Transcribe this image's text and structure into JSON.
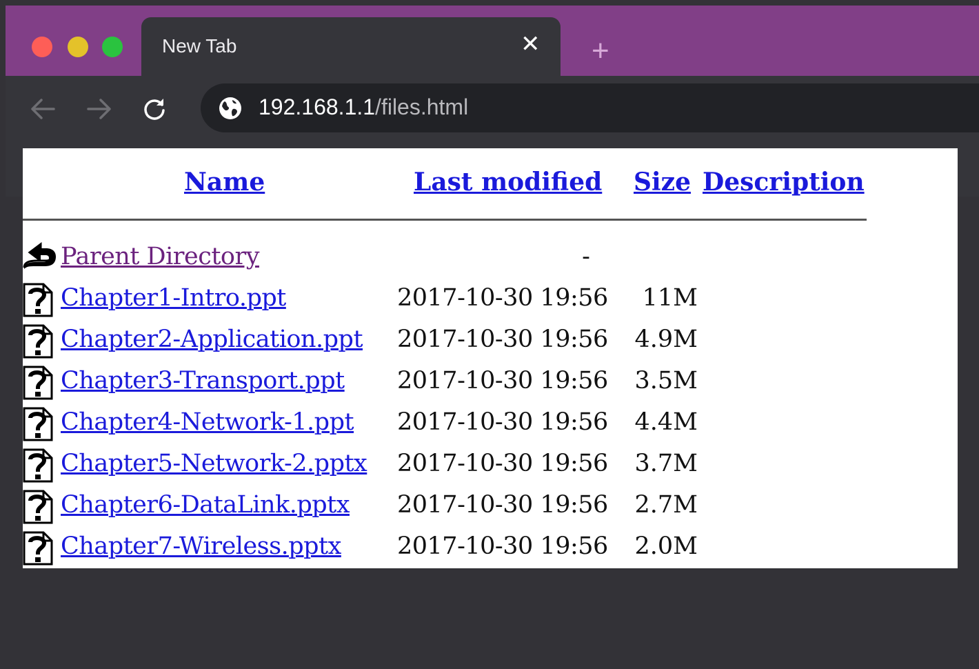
{
  "browser": {
    "tab_title": "New Tab",
    "tab_close": "✕",
    "new_tab": "+",
    "url_host": "192.168.1.1",
    "url_path": "/files.html",
    "accent": "#813f87"
  },
  "listing": {
    "headers": {
      "name": "Name",
      "last_modified": "Last modified",
      "size": "Size",
      "description": "Description"
    },
    "parent": {
      "label": "Parent Directory",
      "size": "-",
      "icon": "back-arrow-icon"
    },
    "files": [
      {
        "name": "Chapter1-Intro.ppt",
        "date": "2017-10-30 19:56",
        "size": "11M",
        "icon": "unknown-file-icon"
      },
      {
        "name": "Chapter2-Application.ppt",
        "date": "2017-10-30 19:56",
        "size": "4.9M",
        "icon": "unknown-file-icon"
      },
      {
        "name": "Chapter3-Transport.ppt",
        "date": "2017-10-30 19:56",
        "size": "3.5M",
        "icon": "unknown-file-icon"
      },
      {
        "name": "Chapter4-Network-1.ppt",
        "date": "2017-10-30 19:56",
        "size": "4.4M",
        "icon": "unknown-file-icon"
      },
      {
        "name": "Chapter5-Network-2.pptx",
        "date": "2017-10-30 19:56",
        "size": "3.7M",
        "icon": "unknown-file-icon"
      },
      {
        "name": "Chapter6-DataLink.pptx",
        "date": "2017-10-30 19:56",
        "size": "2.7M",
        "icon": "unknown-file-icon"
      },
      {
        "name": "Chapter7-Wireless.pptx",
        "date": "2017-10-30 19:56",
        "size": "2.0M",
        "icon": "unknown-file-icon"
      }
    ]
  }
}
